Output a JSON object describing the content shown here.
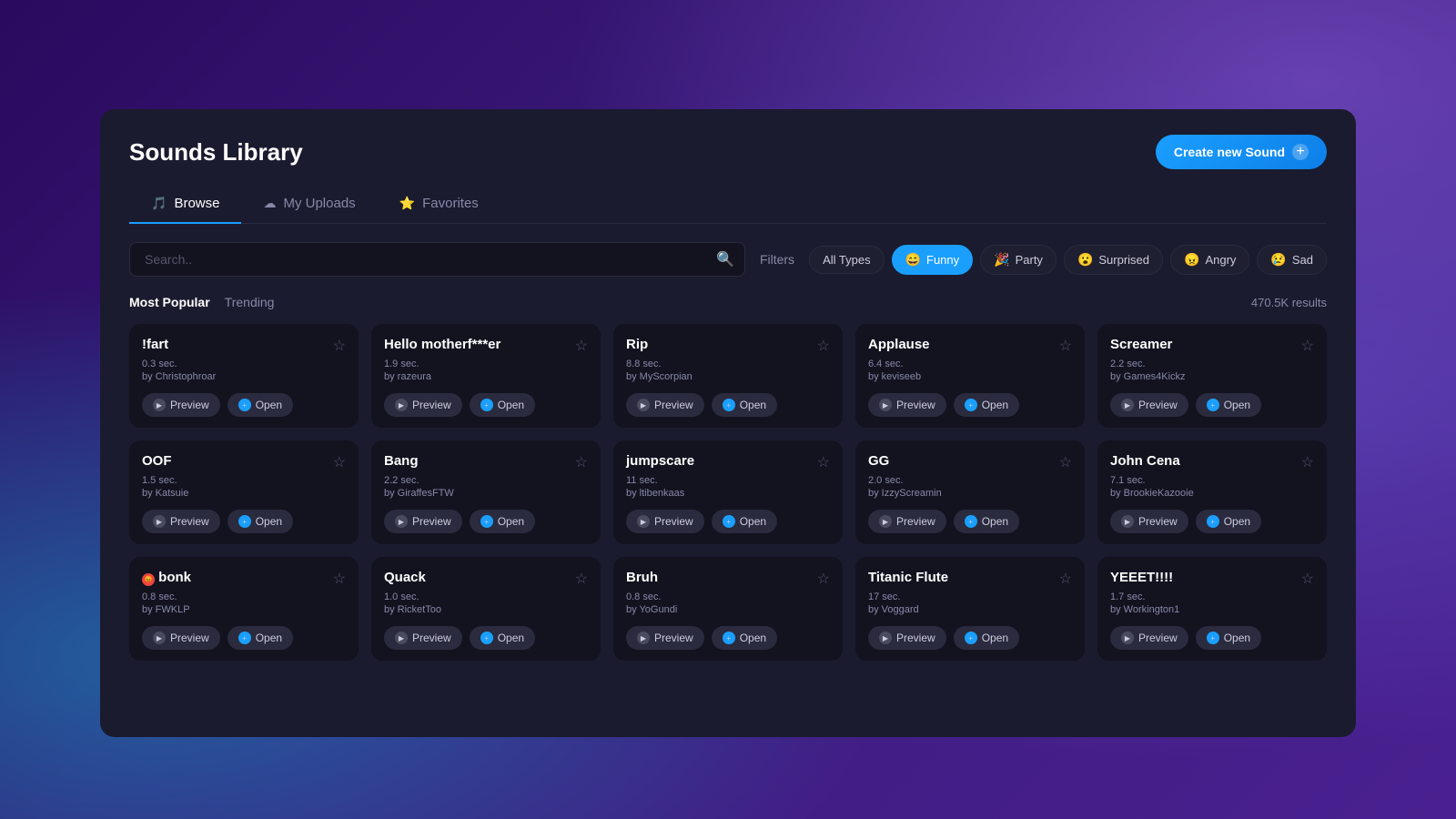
{
  "page": {
    "title": "Sounds Library",
    "create_button": "Create new Sound",
    "background_color": "#1a1b2e"
  },
  "tabs": [
    {
      "id": "browse",
      "label": "Browse",
      "icon": "🎵",
      "active": true
    },
    {
      "id": "my-uploads",
      "label": "My Uploads",
      "icon": "☁",
      "active": false
    },
    {
      "id": "favorites",
      "label": "Favorites",
      "icon": "⭐",
      "active": false
    }
  ],
  "search": {
    "placeholder": "Search..",
    "value": ""
  },
  "filters_label": "Filters",
  "filter_chips": [
    {
      "id": "all",
      "label": "All Types",
      "icon": "",
      "active": false
    },
    {
      "id": "funny",
      "label": "Funny",
      "icon": "😄",
      "active": true
    },
    {
      "id": "party",
      "label": "Party",
      "icon": "🎉",
      "active": false
    },
    {
      "id": "surprised",
      "label": "Surprised",
      "icon": "😮",
      "active": false
    },
    {
      "id": "angry",
      "label": "Angry",
      "icon": "😠",
      "active": false
    },
    {
      "id": "sad",
      "label": "Sad",
      "icon": "😢",
      "active": false
    }
  ],
  "sort": {
    "options": [
      {
        "id": "most-popular",
        "label": "Most Popular",
        "active": true
      },
      {
        "id": "trending",
        "label": "Trending",
        "active": false
      }
    ],
    "results_count": "470.5K results"
  },
  "sounds": [
    {
      "id": 1,
      "name": "!fart",
      "duration": "0.3 sec.",
      "author": "by Christophroar",
      "starred": false,
      "special": null
    },
    {
      "id": 2,
      "name": "Hello motherf***er",
      "duration": "1.9 sec.",
      "author": "by razeura",
      "starred": false,
      "special": null
    },
    {
      "id": 3,
      "name": "Rip",
      "duration": "8.8 sec.",
      "author": "by MyScorpian",
      "starred": false,
      "special": null
    },
    {
      "id": 4,
      "name": "Applause",
      "duration": "6.4 sec.",
      "author": "by keviseeb",
      "starred": false,
      "special": null
    },
    {
      "id": 5,
      "name": "Screamer",
      "duration": "2.2 sec.",
      "author": "by Games4Kickz",
      "starred": false,
      "special": null
    },
    {
      "id": 6,
      "name": "OOF",
      "duration": "1.5 sec.",
      "author": "by Katsuie",
      "starred": false,
      "special": null
    },
    {
      "id": 7,
      "name": "Bang",
      "duration": "2.2 sec.",
      "author": "by GiraffesFTW",
      "starred": false,
      "special": null
    },
    {
      "id": 8,
      "name": "jumpscare",
      "duration": "11 sec.",
      "author": "by ltibenkaas",
      "starred": false,
      "special": null
    },
    {
      "id": 9,
      "name": "GG",
      "duration": "2.0 sec.",
      "author": "by IzzyScreamin",
      "starred": false,
      "special": null
    },
    {
      "id": 10,
      "name": "John Cena",
      "duration": "7.1 sec.",
      "author": "by BrookieKazooie",
      "starred": false,
      "special": null
    },
    {
      "id": 11,
      "name": "bonk",
      "duration": "0.8 sec.",
      "author": "by FWKLP",
      "starred": false,
      "special": "bonk"
    },
    {
      "id": 12,
      "name": "Quack",
      "duration": "1.0 sec.",
      "author": "by RicketToo",
      "starred": false,
      "special": null
    },
    {
      "id": 13,
      "name": "Bruh",
      "duration": "0.8 sec.",
      "author": "by YoGundi",
      "starred": false,
      "special": null
    },
    {
      "id": 14,
      "name": "Titanic Flute",
      "duration": "17 sec.",
      "author": "by Voggard",
      "starred": false,
      "special": null
    },
    {
      "id": 15,
      "name": "YEEET!!!!",
      "duration": "1.7 sec.",
      "author": "by Workington1",
      "starred": false,
      "special": null
    }
  ],
  "buttons": {
    "preview": "Preview",
    "open": "Open"
  }
}
